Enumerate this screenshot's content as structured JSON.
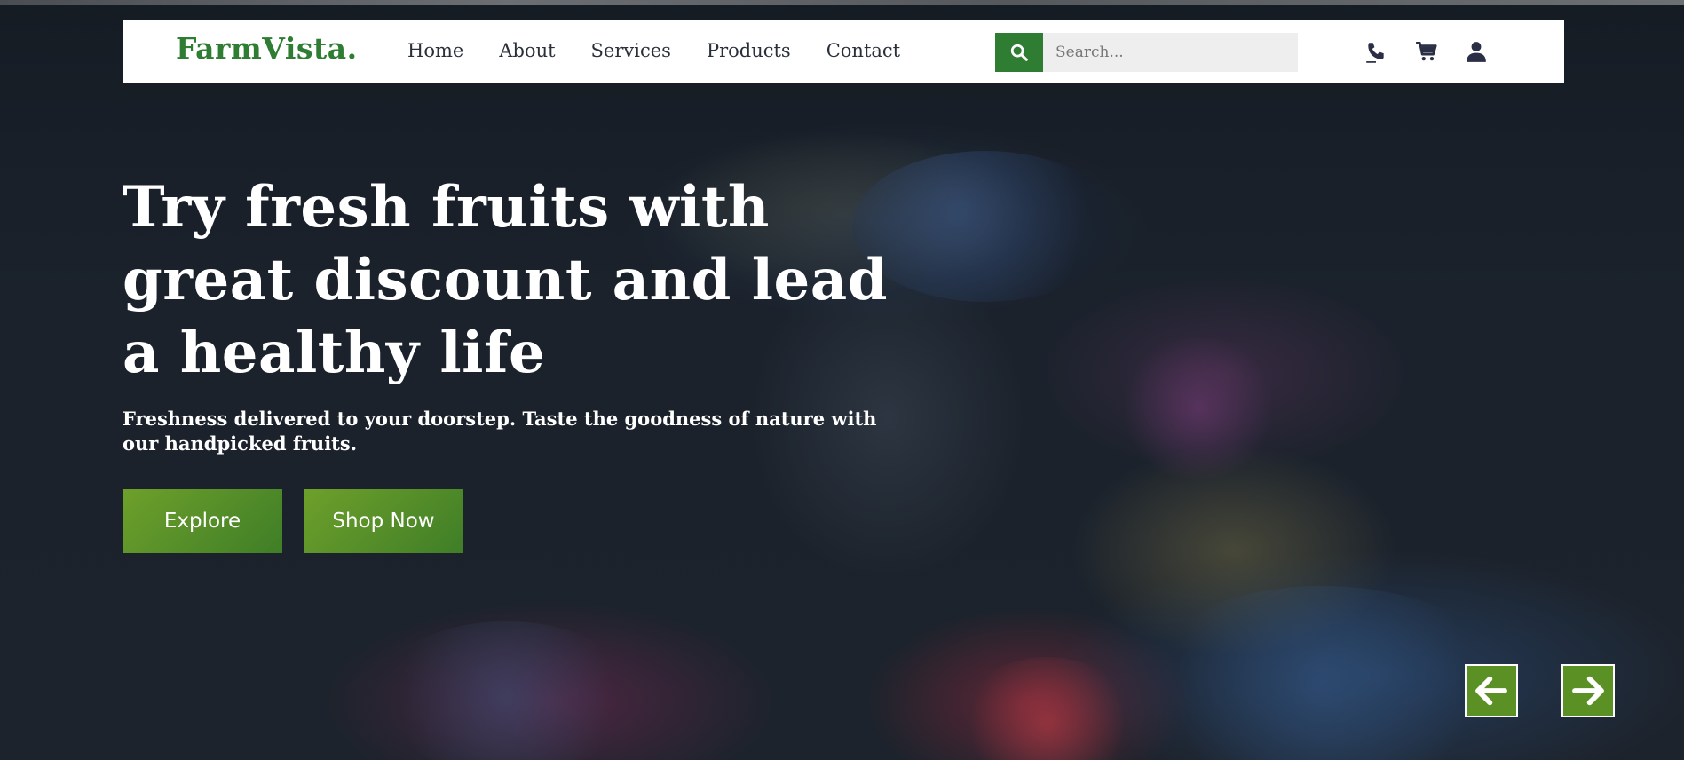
{
  "brand": {
    "name": "FarmVista.",
    "color": "#2e7d32"
  },
  "nav": {
    "items": [
      {
        "label": "Home"
      },
      {
        "label": "About"
      },
      {
        "label": "Services"
      },
      {
        "label": "Products"
      },
      {
        "label": "Contact"
      }
    ]
  },
  "search": {
    "placeholder": "Search...",
    "value": "",
    "icon": "search-icon"
  },
  "header_icons": [
    "phone-icon",
    "cart-icon",
    "user-icon"
  ],
  "hero": {
    "title": "Try fresh fruits with great discount and lead a healthy life",
    "subtitle": "Freshness delivered to your doorstep. Taste the goodness of nature with our handpicked fruits.",
    "buttons": {
      "explore": "Explore",
      "shop_now": "Shop Now"
    }
  },
  "slider": {
    "prev_icon": "arrow-left-icon",
    "next_icon": "arrow-right-icon"
  },
  "colors": {
    "accent": "#2e7d32",
    "button": "#5b9124",
    "header_bg": "#ffffff",
    "hero_text": "#ffffff"
  }
}
